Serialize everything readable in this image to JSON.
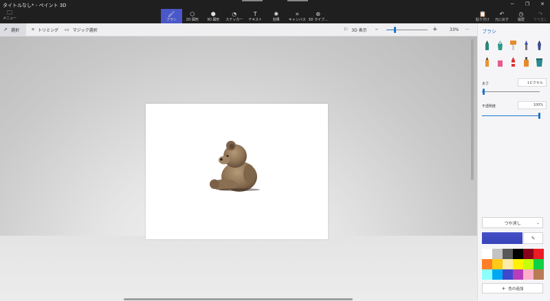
{
  "window": {
    "title": "タイトルなし* - ペイント 3D",
    "minimize": "─",
    "maximize": "❐",
    "close": "✕"
  },
  "menu": {
    "icon": "folder-icon",
    "label": "メニュー",
    "glyph": "🗀"
  },
  "ribbon_tools": [
    {
      "name": "brushes",
      "label": "ブラシ",
      "glyph": "🖌",
      "active": true
    },
    {
      "name": "2d-shapes",
      "label": "2D 図形",
      "glyph": "⬡",
      "active": false
    },
    {
      "name": "3d-shapes",
      "label": "3D 図形",
      "glyph": "⬢",
      "active": false
    },
    {
      "name": "stickers",
      "label": "ステッカー",
      "glyph": "◔",
      "active": false
    },
    {
      "name": "text",
      "label": "テキスト",
      "glyph": "T",
      "active": false
    },
    {
      "name": "effects",
      "label": "効果",
      "glyph": "✺",
      "active": false
    },
    {
      "name": "canvas",
      "label": "キャンバス",
      "glyph": "⌗",
      "active": false
    },
    {
      "name": "3d-library",
      "label": "3D ライブ...",
      "glyph": "⊛",
      "active": false
    }
  ],
  "right_tools": [
    {
      "name": "paste",
      "label": "貼り付け",
      "glyph": "📋",
      "disabled": false
    },
    {
      "name": "undo",
      "label": "元に戻す",
      "glyph": "↶",
      "disabled": false
    },
    {
      "name": "history",
      "label": "履歴",
      "glyph": "◷",
      "disabled": false
    },
    {
      "name": "redo",
      "label": "やり直し",
      "glyph": "↷",
      "disabled": true
    }
  ],
  "toolbar": {
    "select": "選択",
    "crop": "トリミング",
    "magic_select": "マジック選択",
    "view_3d": "3D 表示",
    "zoom_minus": "─",
    "zoom_plus": "+",
    "zoom_level": "33%",
    "zoom_fraction": 0.22,
    "more": "···"
  },
  "panel": {
    "title": "ブラシ",
    "brushes": [
      "marker",
      "calligraphy-pen",
      "oil-brush",
      "watercolor",
      "pixel-pen",
      "pencil",
      "eraser",
      "crayon",
      "spray-can",
      "fill"
    ],
    "thickness_label": "太さ",
    "thickness_value": "1ピクセル",
    "thickness_fraction": 0.04,
    "opacity_label": "不透明度",
    "opacity_value": "100%",
    "opacity_fraction": 1.0,
    "finish": "つや消し",
    "current_color": "#4650c8",
    "add_color": "色の追加",
    "palette": [
      "#ffffff",
      "#c3c3c3",
      "#585858",
      "#000000",
      "#88001b",
      "#ec1c24",
      "#ff7f27",
      "#ffca18",
      "#fdeca6",
      "#fff200",
      "#c4ff0e",
      "#0ed145",
      "#8cfffb",
      "#00a8f3",
      "#3f48cc",
      "#b83dba",
      "#ffaec8",
      "#b97a56"
    ]
  },
  "colors": {
    "accent": "#1a73c7",
    "active_tool": "#4a57c8",
    "panel_title": "#2a6ac7"
  }
}
